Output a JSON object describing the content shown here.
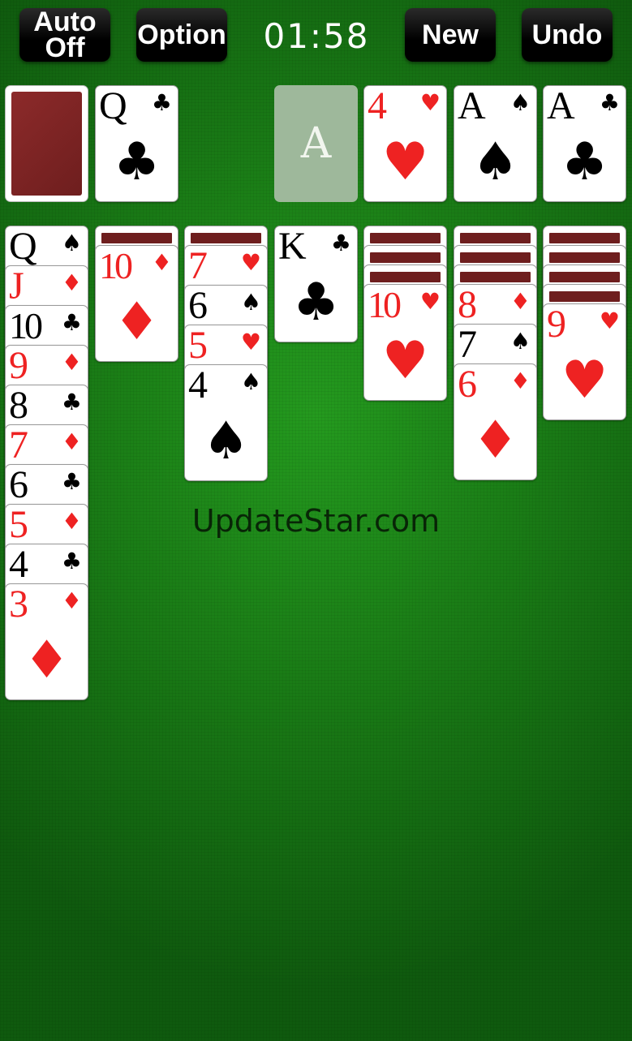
{
  "toolbar": {
    "auto_line1": "Auto",
    "auto_line2": "Off",
    "option_label": "Option",
    "timer": "01:58",
    "new_label": "New",
    "undo_label": "Undo"
  },
  "waste_top": {
    "rank": "Q",
    "suit": "♣",
    "color": "black"
  },
  "foundations": [
    {
      "empty": true,
      "label": "A"
    },
    {
      "rank": "4",
      "suit": "♥",
      "color": "red"
    },
    {
      "rank": "A",
      "suit": "♠",
      "color": "black"
    },
    {
      "rank": "A",
      "suit": "♣",
      "color": "black"
    }
  ],
  "tableau": [
    {
      "hidden": 0,
      "cards": [
        {
          "rank": "Q",
          "suit": "♠",
          "color": "black"
        },
        {
          "rank": "J",
          "suit": "♦",
          "color": "red"
        },
        {
          "rank": "10",
          "suit": "♣",
          "color": "black"
        },
        {
          "rank": "9",
          "suit": "♦",
          "color": "red"
        },
        {
          "rank": "8",
          "suit": "♣",
          "color": "black"
        },
        {
          "rank": "7",
          "suit": "♦",
          "color": "red"
        },
        {
          "rank": "6",
          "suit": "♣",
          "color": "black"
        },
        {
          "rank": "5",
          "suit": "♦",
          "color": "red"
        },
        {
          "rank": "4",
          "suit": "♣",
          "color": "black"
        },
        {
          "rank": "3",
          "suit": "♦",
          "color": "red"
        }
      ]
    },
    {
      "hidden": 1,
      "cards": [
        {
          "rank": "10",
          "suit": "♦",
          "color": "red"
        }
      ]
    },
    {
      "hidden": 1,
      "cards": [
        {
          "rank": "7",
          "suit": "♥",
          "color": "red"
        },
        {
          "rank": "6",
          "suit": "♠",
          "color": "black"
        },
        {
          "rank": "5",
          "suit": "♥",
          "color": "red"
        },
        {
          "rank": "4",
          "suit": "♠",
          "color": "black"
        }
      ]
    },
    {
      "hidden": 0,
      "cards": [
        {
          "rank": "K",
          "suit": "♣",
          "color": "black"
        }
      ]
    },
    {
      "hidden": 3,
      "cards": [
        {
          "rank": "10",
          "suit": "♥",
          "color": "red"
        }
      ]
    },
    {
      "hidden": 3,
      "cards": [
        {
          "rank": "8",
          "suit": "♦",
          "color": "red"
        },
        {
          "rank": "7",
          "suit": "♠",
          "color": "black"
        },
        {
          "rank": "6",
          "suit": "♦",
          "color": "red"
        }
      ]
    },
    {
      "hidden": 4,
      "cards": [
        {
          "rank": "9",
          "suit": "♥",
          "color": "red"
        }
      ]
    }
  ],
  "watermark": "UpdateStar.com"
}
